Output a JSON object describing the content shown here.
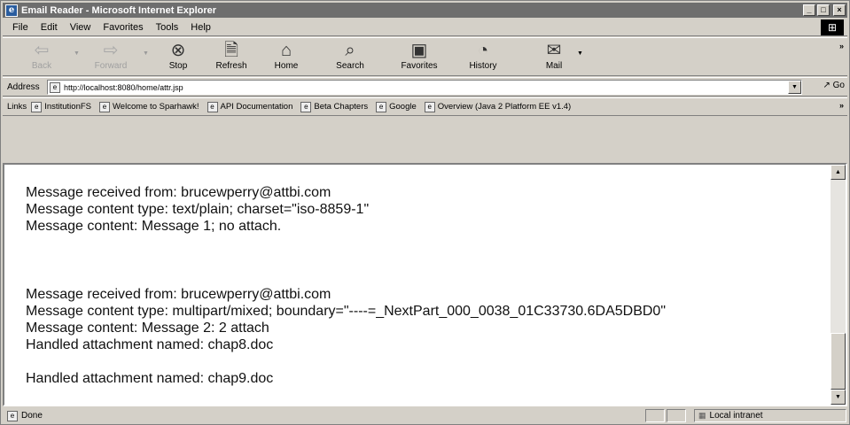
{
  "window": {
    "title": "Email Reader - Microsoft Internet Explorer",
    "buttons": {
      "minimize": "_",
      "maximize": "□",
      "close": "×"
    }
  },
  "menubar": {
    "items": [
      {
        "label": "File",
        "accel": "F"
      },
      {
        "label": "Edit",
        "accel": "E"
      },
      {
        "label": "View",
        "accel": "V"
      },
      {
        "label": "Favorites",
        "accel": "a"
      },
      {
        "label": "Tools",
        "accel": "T"
      },
      {
        "label": "Help",
        "accel": "H"
      }
    ]
  },
  "toolbar": {
    "back": "Back",
    "forward": "Forward",
    "stop": "Stop",
    "refresh": "Refresh",
    "home": "Home",
    "search": "Search",
    "favorites": "Favorites",
    "history": "History",
    "mail": "Mail"
  },
  "address": {
    "label": "Address",
    "url": "http://localhost:8080/home/attr.jsp",
    "go": "Go"
  },
  "links": {
    "label": "Links",
    "items": [
      "InstitutionFS",
      "Welcome to Sparhawk!",
      "API Documentation",
      "Beta Chapters",
      "Google",
      "Overview (Java 2 Platform EE v1.4)"
    ]
  },
  "content": {
    "message1": [
      "Message received from: brucewperry@attbi.com",
      "Message content type: text/plain; charset=\"iso-8859-1\"",
      "Message content: Message 1; no attach."
    ],
    "message2": [
      "Message received from: brucewperry@attbi.com",
      "Message content type: multipart/mixed; boundary=\"----=_NextPart_000_0038_01C33730.6DA5DBD0\"",
      "Message content: Message 2: 2 attach",
      "Handled attachment named: chap8.doc"
    ],
    "attachment2": "Handled attachment named: chap9.doc"
  },
  "status": {
    "text": "Done",
    "zone": "Local intranet"
  }
}
